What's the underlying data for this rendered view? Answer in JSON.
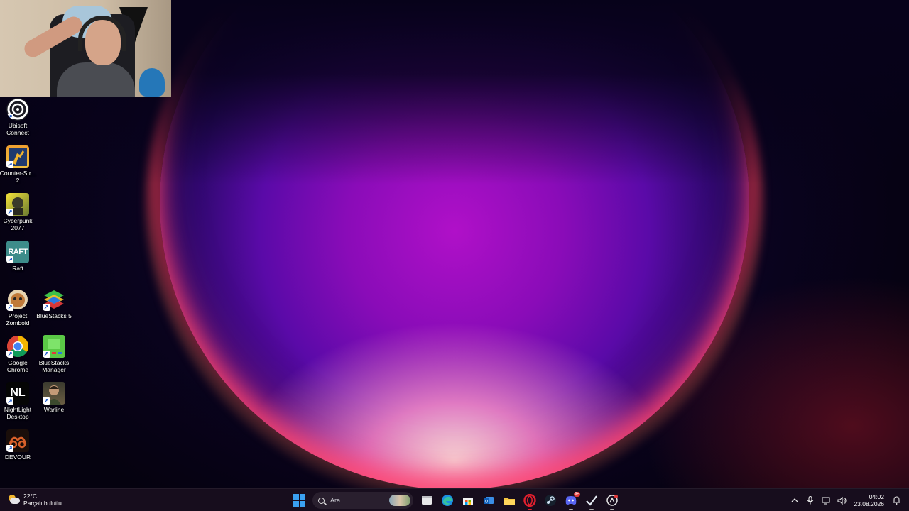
{
  "desktop": {
    "icons": [
      {
        "label": "Ubisoft Connect",
        "icon": "ubisoft-icon"
      },
      {
        "label": "Counter-Str... 2",
        "icon": "counter-strike-icon"
      },
      {
        "label": "Cyberpunk 2077",
        "icon": "cyberpunk-icon"
      },
      {
        "label": "Raft",
        "icon": "raft-icon",
        "glyph": "RAFT"
      },
      {
        "label": "Project Zomboid",
        "icon": "project-zomboid-icon"
      },
      {
        "label": "BlueStacks 5",
        "icon": "bluestacks-icon"
      },
      {
        "label": "Google Chrome",
        "icon": "chrome-icon"
      },
      {
        "label": "BlueStacks Manager",
        "icon": "bluestacks-manager-icon"
      },
      {
        "label": "NightLight Desktop",
        "icon": "nightlight-icon",
        "glyph": "NL"
      },
      {
        "label": "Warline",
        "icon": "warline-icon"
      },
      {
        "label": "DEVOUR",
        "icon": "devour-icon"
      }
    ]
  },
  "taskbar": {
    "weather": {
      "temp": "22°C",
      "desc": "Parçalı bulutlu"
    },
    "search_placeholder": "Ara",
    "apps": [
      "file-explorer-icon",
      "edge-icon",
      "store-icon",
      "outlook-icon",
      "folder-icon",
      "opera-icon",
      "steam-icon",
      "discord-icon",
      "steam-alt-icon",
      "app-icon"
    ],
    "discord_badge": "9+",
    "clock": {
      "time": "04:02",
      "date": "23.08.2026"
    }
  },
  "colors": {
    "taskbar_bg": "#180e1e",
    "start_blue": "#3aa0f0",
    "orb_magenta": "#b010c8"
  }
}
